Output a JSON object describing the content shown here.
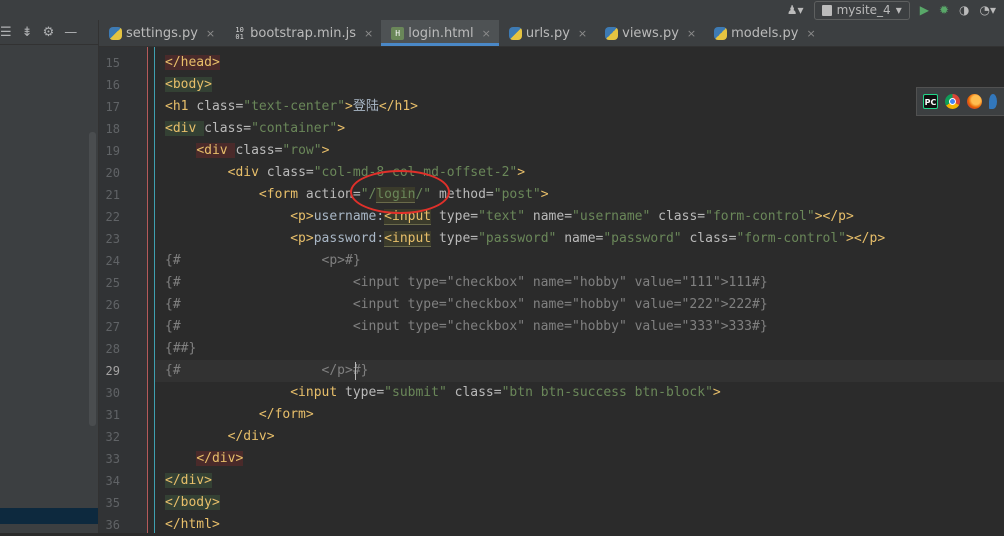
{
  "toolbar": {
    "user_icon": "user-dropdown-icon",
    "run_config": "mysite_4",
    "run_config_arrow": "▾",
    "actions": [
      "run-icon",
      "debug-icon",
      "coverage-icon",
      "profile-icon"
    ]
  },
  "left_panel": {
    "tools": [
      "expand-icon",
      "collapse-icon",
      "gear-icon",
      "minimize-icon"
    ]
  },
  "tabs": [
    {
      "label": "settings.py",
      "type": "py",
      "active": false
    },
    {
      "label": "bootstrap.min.js",
      "type": "js",
      "active": false
    },
    {
      "label": "login.html",
      "type": "html",
      "active": true
    },
    {
      "label": "urls.py",
      "type": "py",
      "active": false
    },
    {
      "label": "views.py",
      "type": "py",
      "active": false
    },
    {
      "label": "models.py",
      "type": "py",
      "active": false
    }
  ],
  "tab_close": "×",
  "js_icon_text": "101\n010",
  "html_icon_text": "H",
  "gutter": {
    "line_numbers": [
      "15",
      "16",
      "17",
      "18",
      "19",
      "20",
      "21",
      "22",
      "23",
      "24",
      "25",
      "26",
      "27",
      "28",
      "29",
      "30",
      "31",
      "32",
      "33",
      "34",
      "35",
      "36"
    ],
    "current_line": "29"
  },
  "code": {
    "l15_tag": "</head>",
    "l16_tag": "<body>",
    "l17_open": "<h1 ",
    "l17_attr": "class=",
    "l17_val": "\"text-center\"",
    "l17_close": ">",
    "l17_text": "登陆",
    "l17_end": "</h1>",
    "l18_open": "<div ",
    "l18_attr": "class=",
    "l18_val": "\"container\"",
    "l18_close": ">",
    "l19_indent": "    ",
    "l19_open": "<div ",
    "l19_attr": "class=",
    "l19_val": "\"row\"",
    "l19_close": ">",
    "l20_indent": "        ",
    "l20_open": "<div ",
    "l20_attr": "class=",
    "l20_val": "\"col-md-8 col-md-offset-2\"",
    "l20_close": ">",
    "l21_indent": "            ",
    "l21_open": "<form ",
    "l21_attr1": "action=",
    "l21_q1": "\"/",
    "l21_hl": "login",
    "l21_q2": "/\"",
    "l21_attr2": " method=",
    "l21_val2": "\"post\"",
    "l21_close": ">",
    "l22_indent": "                ",
    "l22_p": "<p>",
    "l22_text": "username:",
    "l22_open": "<input",
    "l22_a1": " type=",
    "l22_v1": "\"text\"",
    "l22_a2": " name=",
    "l22_v2": "\"username\"",
    "l22_a3": " class=",
    "l22_v3": "\"form-control\"",
    "l22_close": "></p>",
    "l23_indent": "                ",
    "l23_p": "<p>",
    "l23_text": "password:",
    "l23_open": "<input",
    "l23_a1": " type=",
    "l23_v1": "\"password\"",
    "l23_a2": " name=",
    "l23_v2": "\"password\"",
    "l23_a3": " class=",
    "l23_v3": "\"form-control\"",
    "l23_close": "></p>",
    "l24": "{#                  <p>#}",
    "l25": "{#                      <input type=\"checkbox\" name=\"hobby\" value=\"111\">111#}",
    "l26": "{#                      <input type=\"checkbox\" name=\"hobby\" value=\"222\">222#}",
    "l27": "{#                      <input type=\"checkbox\" name=\"hobby\" value=\"333\">333#}",
    "l28": "{##}",
    "l29": "{#                  </p>#}",
    "l30_indent": "                ",
    "l30_open": "<input",
    "l30_a1": " type=",
    "l30_v1": "\"submit\"",
    "l30_a2": " class=",
    "l30_v2": "\"btn btn-success btn-block\"",
    "l30_close": ">",
    "l31_indent": "            ",
    "l31_tag": "</form>",
    "l32_indent": "        ",
    "l32_tag": "</div>",
    "l33_indent": "    ",
    "l33_tag": "</div>",
    "l34_tag": "</div>",
    "l35_tag": "</body>",
    "l36_tag": "</html>"
  },
  "browsers": {
    "pc_label": "PC",
    "items": [
      "pycharm-icon",
      "chrome-icon",
      "firefox-icon",
      "edge-icon"
    ]
  },
  "colors": {
    "tag": "#e8bf6a",
    "attribute": "#bababa",
    "string": "#6a8759",
    "comment": "#808080",
    "annotation_circle": "#e0302a",
    "active_tab_underline": "#4a88c7"
  }
}
